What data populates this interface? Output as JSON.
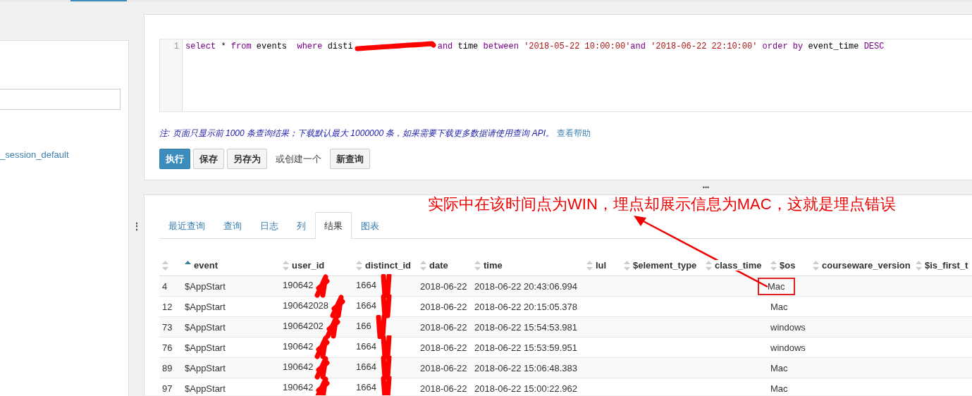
{
  "sidebar": {
    "items": [
      {
        "label": "_session_default"
      }
    ]
  },
  "query": {
    "line_number": "1",
    "tokens": [
      {
        "text": "select",
        "kind": "keyword"
      },
      {
        "text": " * ",
        "kind": "plain"
      },
      {
        "text": "from",
        "kind": "keyword"
      },
      {
        "text": " events  ",
        "kind": "plain"
      },
      {
        "text": "where",
        "kind": "keyword"
      },
      {
        "text": " disti",
        "kind": "plain",
        "redacted": true
      },
      {
        "text": "and",
        "kind": "keyword"
      },
      {
        "text": " time ",
        "kind": "plain"
      },
      {
        "text": "between ",
        "kind": "keyword"
      },
      {
        "text": "'2018-05-22 10:00:00'",
        "kind": "string"
      },
      {
        "text": "and ",
        "kind": "keyword"
      },
      {
        "text": "'2018-06-22 22:10:00'",
        "kind": "string"
      },
      {
        "text": " order by",
        "kind": "keyword"
      },
      {
        "text": " event_time ",
        "kind": "plain"
      },
      {
        "text": "DESC",
        "kind": "keyword"
      }
    ],
    "note": "注: 页面只显示前 1000 条查询结果；下载默认最大 1000000 条，如果需要下载更多数据请使用查询 API。",
    "help_link": "查看帮助",
    "buttons": [
      {
        "label": "执行",
        "kind": "primary"
      },
      {
        "label": "保存",
        "kind": "default"
      },
      {
        "label": "另存为",
        "kind": "default"
      },
      {
        "label": "或创建一个",
        "kind": "text"
      },
      {
        "label": "新查询",
        "kind": "default"
      }
    ]
  },
  "splitters": {
    "vertical": "⋮",
    "horizontal": "•••"
  },
  "results": {
    "tabs": [
      {
        "label": "最近查询",
        "selected": false
      },
      {
        "label": "查询",
        "selected": false
      },
      {
        "label": "日志",
        "selected": false
      },
      {
        "label": "列",
        "selected": false
      },
      {
        "label": "结果",
        "selected": true
      },
      {
        "label": "图表",
        "selected": false
      }
    ],
    "columns": [
      {
        "sorted": false
      },
      {
        "label": "event",
        "sorted": true
      },
      {
        "label": "user_id",
        "sorted": false
      },
      {
        "label": "distinct_id",
        "sorted": false
      },
      {
        "label": "date",
        "sorted": false
      },
      {
        "label": "time",
        "sorted": false
      },
      {
        "label": "lul",
        "sorted": false
      },
      {
        "label": "$element_type",
        "sorted": false
      },
      {
        "label": "class_time",
        "sorted": false
      },
      {
        "label": "$os",
        "sorted": false
      },
      {
        "label": "courseware_version",
        "sorted": false
      },
      {
        "label": "$is_first_t",
        "sorted": false
      }
    ],
    "rows": [
      {
        "cells": [
          "4",
          "$AppStart",
          "190642",
          "1664",
          "2018-06-22",
          "2018-06-22 20:43:06.994",
          "",
          "",
          "",
          "Mac",
          "",
          ""
        ],
        "annotated": true
      },
      {
        "cells": [
          "12",
          "$AppStart",
          "190642028",
          "1664",
          "2018-06-22",
          "2018-06-22 20:15:05.378",
          "",
          "",
          "",
          "Mac",
          "",
          ""
        ],
        "annotated": false
      },
      {
        "cells": [
          "73",
          "$AppStart",
          "19064202",
          "166",
          "2018-06-22",
          "2018-06-22 15:54:53.981",
          "",
          "",
          "",
          "windows",
          "",
          ""
        ],
        "annotated": false
      },
      {
        "cells": [
          "76",
          "$AppStart",
          "190642",
          "1664",
          "2018-06-22",
          "2018-06-22 15:53:59.951",
          "",
          "",
          "",
          "windows",
          "",
          ""
        ],
        "annotated": false
      },
      {
        "cells": [
          "89",
          "$AppStart",
          "190642",
          "1664",
          "2018-06-22",
          "2018-06-22 15:06:48.383",
          "",
          "",
          "",
          "Mac",
          "",
          ""
        ],
        "annotated": false
      },
      {
        "cells": [
          "97",
          "$AppStart",
          "190642",
          "1664",
          "2018-06-22",
          "2018-06-22 15:00:22.962",
          "",
          "",
          "",
          "Mac",
          "",
          ""
        ],
        "annotated": false
      }
    ]
  },
  "annotation": {
    "text": "实际中在该时间点为WIN，埋点却展示信息为MAC，这就是埋点错误"
  }
}
